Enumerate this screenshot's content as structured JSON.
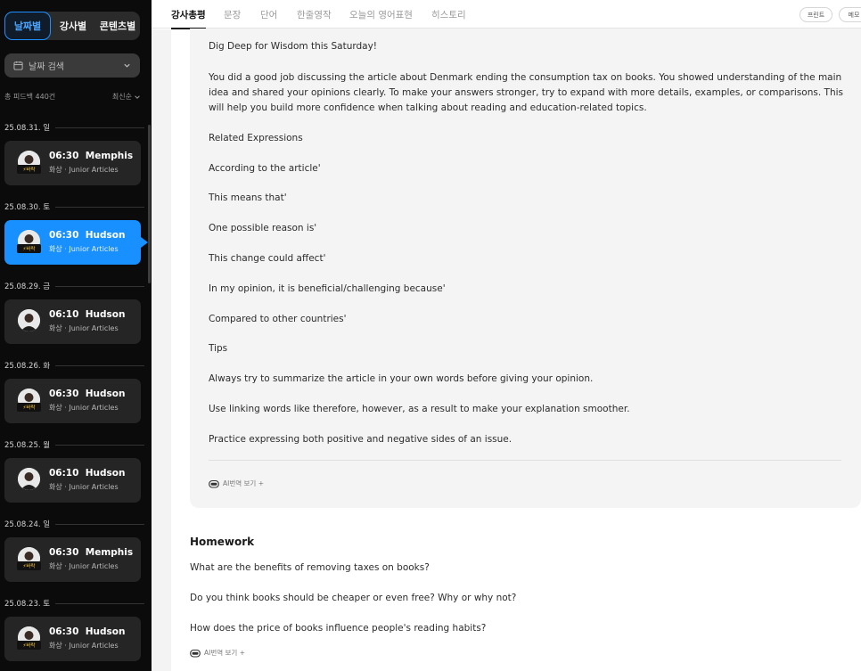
{
  "sidebar": {
    "view_tabs": [
      {
        "label": "날짜별",
        "active": true
      },
      {
        "label": "강사별",
        "active": false
      },
      {
        "label": "콘텐츠별",
        "active": false
      }
    ],
    "date_search_label": "날짜 검색",
    "total_label": "총 피드백 440건",
    "sort_label": "최신순",
    "groups": [
      {
        "date": "25.08.31. 일",
        "time": "06:30",
        "tutor": "Memphis",
        "subtitle": "화상 · Junior Articles",
        "badge": "⚡바락",
        "active": false
      },
      {
        "date": "25.08.30. 토",
        "time": "06:30",
        "tutor": "Hudson",
        "subtitle": "화상 · Junior Articles",
        "badge": "⚡바락",
        "active": true
      },
      {
        "date": "25.08.29. 금",
        "time": "06:10",
        "tutor": "Hudson",
        "subtitle": "화상 · Junior Articles",
        "badge": "",
        "active": false
      },
      {
        "date": "25.08.26. 화",
        "time": "06:30",
        "tutor": "Hudson",
        "subtitle": "화상 · Junior Articles",
        "badge": "⚡바락",
        "active": false
      },
      {
        "date": "25.08.25. 월",
        "time": "06:10",
        "tutor": "Hudson",
        "subtitle": "화상 · Junior Articles",
        "badge": "",
        "active": false
      },
      {
        "date": "25.08.24. 일",
        "time": "06:30",
        "tutor": "Memphis",
        "subtitle": "화상 · Junior Articles",
        "badge": "⚡바락",
        "active": false
      },
      {
        "date": "25.08.23. 토",
        "time": "06:30",
        "tutor": "Hudson",
        "subtitle": "화상 · Junior Articles",
        "badge": "⚡바락",
        "active": false
      }
    ]
  },
  "topnav": {
    "tabs": [
      "강사총평",
      "문장",
      "단어",
      "한줄영작",
      "오늘의 영어표현",
      "히스토리"
    ],
    "print_label": "프린트",
    "memo_label": "메모"
  },
  "feedback": {
    "lines": [
      "Dig Deep for Wisdom this Saturday!",
      "You did a good job discussing the article about Denmark ending the consumption tax on books. You showed understanding of the main idea and shared your opinions clearly. To make your answers stronger, try to expand with more details, examples, or comparisons. This will help you build more confidence when talking about reading and education-related topics.",
      "Related Expressions",
      "According to the article'",
      "This means that'",
      "One possible reason is'",
      "This change could affect'",
      "In my opinion, it is beneficial/challenging because'",
      "Compared to other countries'",
      "Tips",
      "Always try to summarize the article in your own words before giving your opinion.",
      "Use linking words like therefore, however, as a result to make your explanation smoother.",
      "Practice expressing both positive and negative sides of an issue."
    ],
    "ai_translate_label": "AI번역 보기 +"
  },
  "homework": {
    "title": "Homework",
    "questions": [
      "What are the benefits of removing taxes on books?",
      "Do you think books should be cheaper or even free? Why or why not?",
      "How does the price of books influence people's reading habits?"
    ],
    "ai_translate_label": "AI번역 보기 +"
  },
  "colors": {
    "accent": "#1890ff",
    "sidebar_bg": "#0b0b0b",
    "card_bg": "#252525",
    "feedback_bg": "#f4f4f4"
  },
  "icons": {
    "date_search": "calendar-icon",
    "dropdown": "chevron-down-icon",
    "collapse": "chevron-left-icon",
    "ai": "ai-robot-icon"
  }
}
